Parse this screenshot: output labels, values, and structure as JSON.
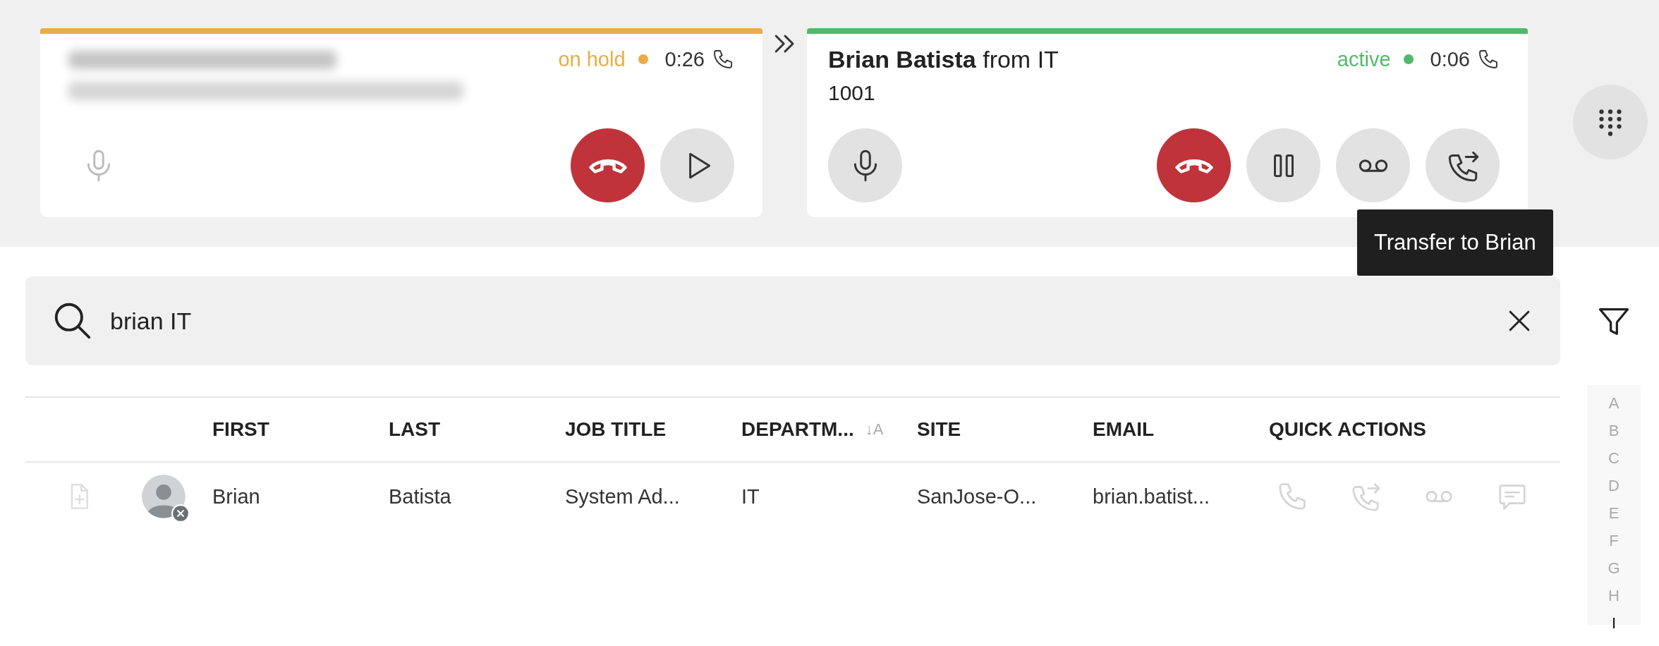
{
  "calls": [
    {
      "status": "on hold",
      "color": "#e8ad45",
      "timer": "0:26",
      "caller_hidden": true,
      "buttons": [
        {
          "kind": "mute",
          "disabled": true
        },
        {
          "kind": "hangup",
          "disabled": false
        },
        {
          "kind": "resume",
          "disabled": false
        }
      ]
    },
    {
      "caller": "**Brian Batista** from IT",
      "number": "1001",
      "status": "active",
      "color": "#52b96a",
      "timer": "0:06",
      "caller_hidden": false,
      "buttons": [
        {
          "kind": "mute",
          "disabled": false
        },
        {
          "kind": "hangup",
          "disabled": false
        },
        {
          "kind": "hold",
          "disabled": false
        },
        {
          "kind": "voicemail",
          "disabled": false
        },
        {
          "kind": "transfer",
          "disabled": false
        }
      ]
    }
  ],
  "tooltip": "Transfer to Brian",
  "search": {
    "value": "brian IT"
  },
  "table": {
    "columns": [
      {
        "label": "FIRST"
      },
      {
        "label": "LAST"
      },
      {
        "label": "JOB TITLE"
      },
      {
        "label": "DEPARTM...",
        "sort_label": "↓A"
      },
      {
        "label": "SITE"
      },
      {
        "label": "EMAIL"
      },
      {
        "label": "QUICK ACTIONS"
      }
    ],
    "rows": [
      {
        "offline": true,
        "cells": [
          "Brian",
          "Batista",
          "System Ad...",
          "IT",
          "SanJose-O...",
          "brian.batist..."
        ],
        "quick_actions": [
          {
            "kind": "call"
          },
          {
            "kind": "transfer"
          },
          {
            "kind": "voicemail"
          },
          {
            "kind": "chat"
          }
        ]
      }
    ]
  },
  "alphabet": [
    {
      "letter": "A",
      "selected": false
    },
    {
      "letter": "B",
      "selected": false
    },
    {
      "letter": "C",
      "selected": false
    },
    {
      "letter": "D",
      "selected": false
    },
    {
      "letter": "E",
      "selected": false
    },
    {
      "letter": "F",
      "selected": false
    },
    {
      "letter": "G",
      "selected": false
    },
    {
      "letter": "H",
      "selected": false
    },
    {
      "letter": "I",
      "selected": true
    }
  ]
}
